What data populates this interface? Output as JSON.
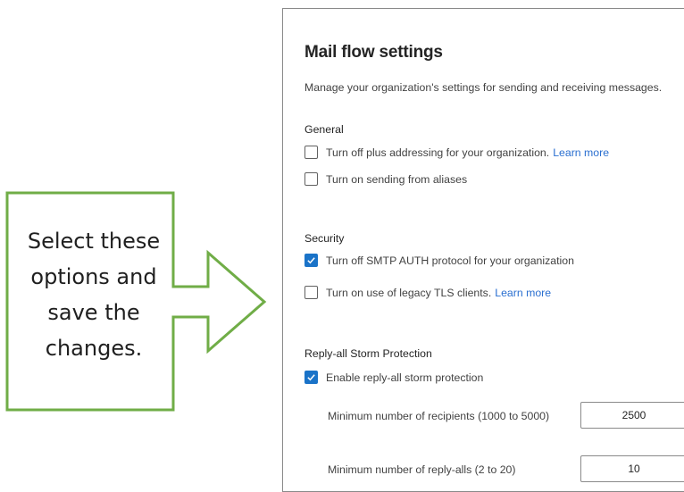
{
  "callout": {
    "text": "Select these\noptions and\nsave the\nchanges.",
    "border_color": "#70ad47"
  },
  "panel": {
    "title": "Mail flow settings",
    "description": "Manage your organization's settings for sending and receiving messages.",
    "general": {
      "heading": "General",
      "plus_addressing": {
        "label": "Turn off plus addressing for your organization.",
        "link": "Learn more",
        "checked": false
      },
      "sending_from_aliases": {
        "label": "Turn on sending from aliases",
        "checked": false
      }
    },
    "security": {
      "heading": "Security",
      "smtp_auth": {
        "label": "Turn off SMTP AUTH protocol for your organization",
        "checked": true
      },
      "legacy_tls": {
        "label": "Turn on use of legacy TLS clients.",
        "link": "Learn more",
        "checked": false
      }
    },
    "reply_all": {
      "heading": "Reply-all Storm Protection",
      "enable": {
        "label": "Enable reply-all storm protection",
        "checked": true
      },
      "min_recipients": {
        "label": "Minimum number of recipients (1000 to 5000)",
        "value": "2500"
      },
      "min_reply_alls": {
        "label": "Minimum number of reply-alls (2 to 20)",
        "value": "10"
      }
    }
  },
  "colors": {
    "checkbox_checked": "#1a73c8",
    "link": "#2a6fd0",
    "arrow_outline": "#70ad47"
  }
}
